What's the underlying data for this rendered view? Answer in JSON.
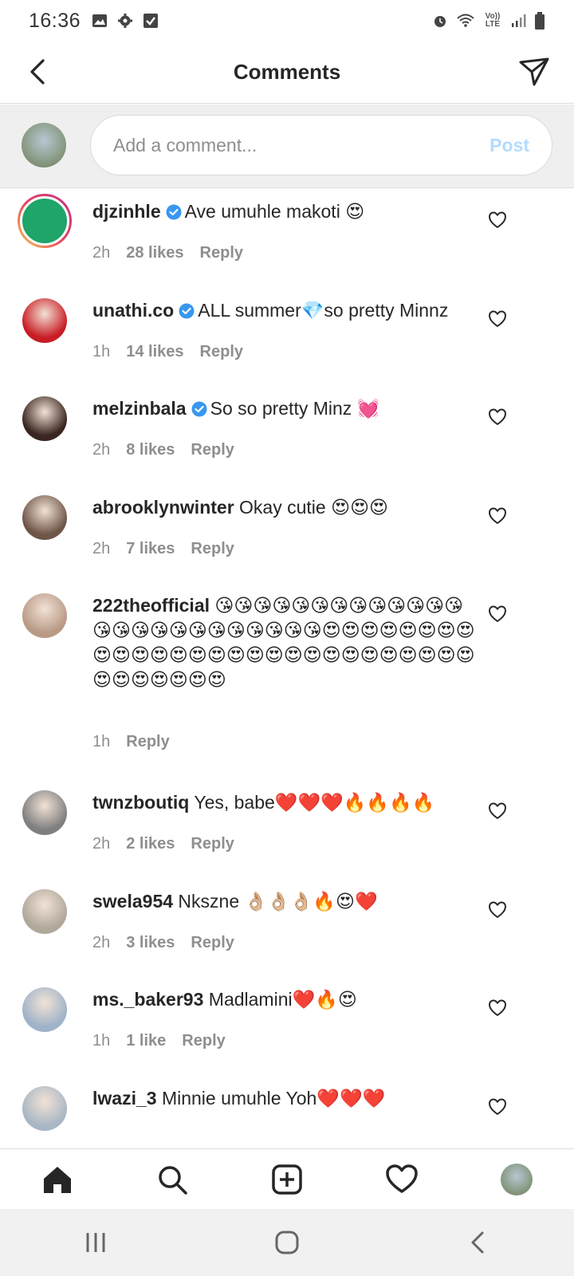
{
  "status_bar": {
    "time": "16:36",
    "left_icons": [
      "gallery-icon",
      "gear-icon",
      "checkbox-icon"
    ],
    "right_icons": [
      "alarm-icon",
      "wifi-icon",
      "lte-icon",
      "signal-icon",
      "battery-icon"
    ],
    "lte_top": "Vo))",
    "lte_bottom": "LTE"
  },
  "header": {
    "title": "Comments",
    "back_icon": "back-arrow-icon",
    "send_icon": "paper-plane-icon"
  },
  "composer": {
    "placeholder": "Add a comment...",
    "post_label": "Post",
    "post_color": "#b3dbff"
  },
  "colors": {
    "verified": "#3897f0",
    "meta": "#8e8e8e",
    "text": "#262626",
    "story_ring": [
      "#f9c74f",
      "#e4405f",
      "#c13584"
    ]
  },
  "comments": [
    {
      "username": "djzinhle",
      "verified": true,
      "text": "Ave umuhle makoti 😍",
      "time": "2h",
      "likes": "28 likes",
      "reply": "Reply",
      "story": true
    },
    {
      "username": "unathi.co",
      "verified": true,
      "text": "ALL summer💎so pretty Minnz",
      "time": "1h",
      "likes": "14 likes",
      "reply": "Reply",
      "story": false
    },
    {
      "username": "melzinbala",
      "verified": true,
      "text": "So so pretty Minz 💓",
      "time": "2h",
      "likes": "8 likes",
      "reply": "Reply",
      "story": false
    },
    {
      "username": "abrooklynwinter",
      "verified": false,
      "text": "Okay cutie 😍😍😍",
      "time": "2h",
      "likes": "7 likes",
      "reply": "Reply",
      "story": false
    },
    {
      "username": "222theofficial",
      "verified": false,
      "text": "😘😘😘😘😘😘😘😘😘😘😘😘😘😘😘😘😘😘😘😘😘😘😘😘😘😍😍😍😍😍😍😍😍😍😍😍😍😍😍😍😍😍😍😍😍😍😍😍😍😍😍😍😍😍😍😍😍😍😍😍",
      "time": "1h",
      "likes": "",
      "reply": "Reply",
      "story": false
    },
    {
      "username": "twnzboutiq",
      "verified": false,
      "text": "Yes, babe❤️❤️❤️🔥🔥🔥🔥",
      "time": "2h",
      "likes": "2 likes",
      "reply": "Reply",
      "story": false
    },
    {
      "username": "swela954",
      "verified": false,
      "text": "Nkszne 👌🏼👌🏼👌🏼🔥😍❤️",
      "time": "2h",
      "likes": "3 likes",
      "reply": "Reply",
      "story": false
    },
    {
      "username": "ms._baker93",
      "verified": false,
      "text": "Madlamini❤️🔥😍",
      "time": "1h",
      "likes": "1 like",
      "reply": "Reply",
      "story": false
    },
    {
      "username": "lwazi_3",
      "verified": false,
      "text": "Minnie umuhle Yoh❤️❤️❤️",
      "time": "",
      "likes": "",
      "reply": "",
      "story": false
    }
  ],
  "bottom_nav": [
    "home-icon",
    "search-icon",
    "new-post-icon",
    "activity-heart-icon",
    "profile-avatar"
  ],
  "system_nav": [
    "recent-apps-icon",
    "home-circle-icon",
    "system-back-icon"
  ]
}
